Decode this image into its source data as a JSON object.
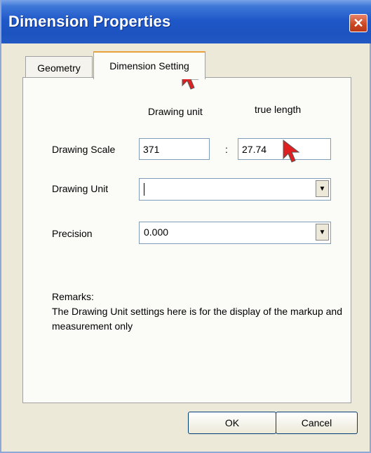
{
  "window": {
    "title": "Dimension Properties",
    "close_icon": "close-icon"
  },
  "tabs": [
    {
      "label": "Geometry",
      "active": false
    },
    {
      "label": "Dimension Setting",
      "active": true
    }
  ],
  "form": {
    "column_drawing_unit": "Drawing unit",
    "column_true_length": "true length",
    "drawing_scale_label": "Drawing Scale",
    "drawing_scale_value": "371",
    "separator": ":",
    "true_length_value": "27.74",
    "drawing_unit_label": "Drawing Unit",
    "drawing_unit_value": "",
    "precision_label": "Precision",
    "precision_value": "0.000",
    "remarks_title": "Remarks:",
    "remarks_text": "The Drawing Unit settings here is for the display of the markup and measurement only"
  },
  "buttons": {
    "ok": "OK",
    "cancel": "Cancel"
  },
  "colors": {
    "title_bar": "#1e57c7",
    "cursor": "#e02020"
  }
}
